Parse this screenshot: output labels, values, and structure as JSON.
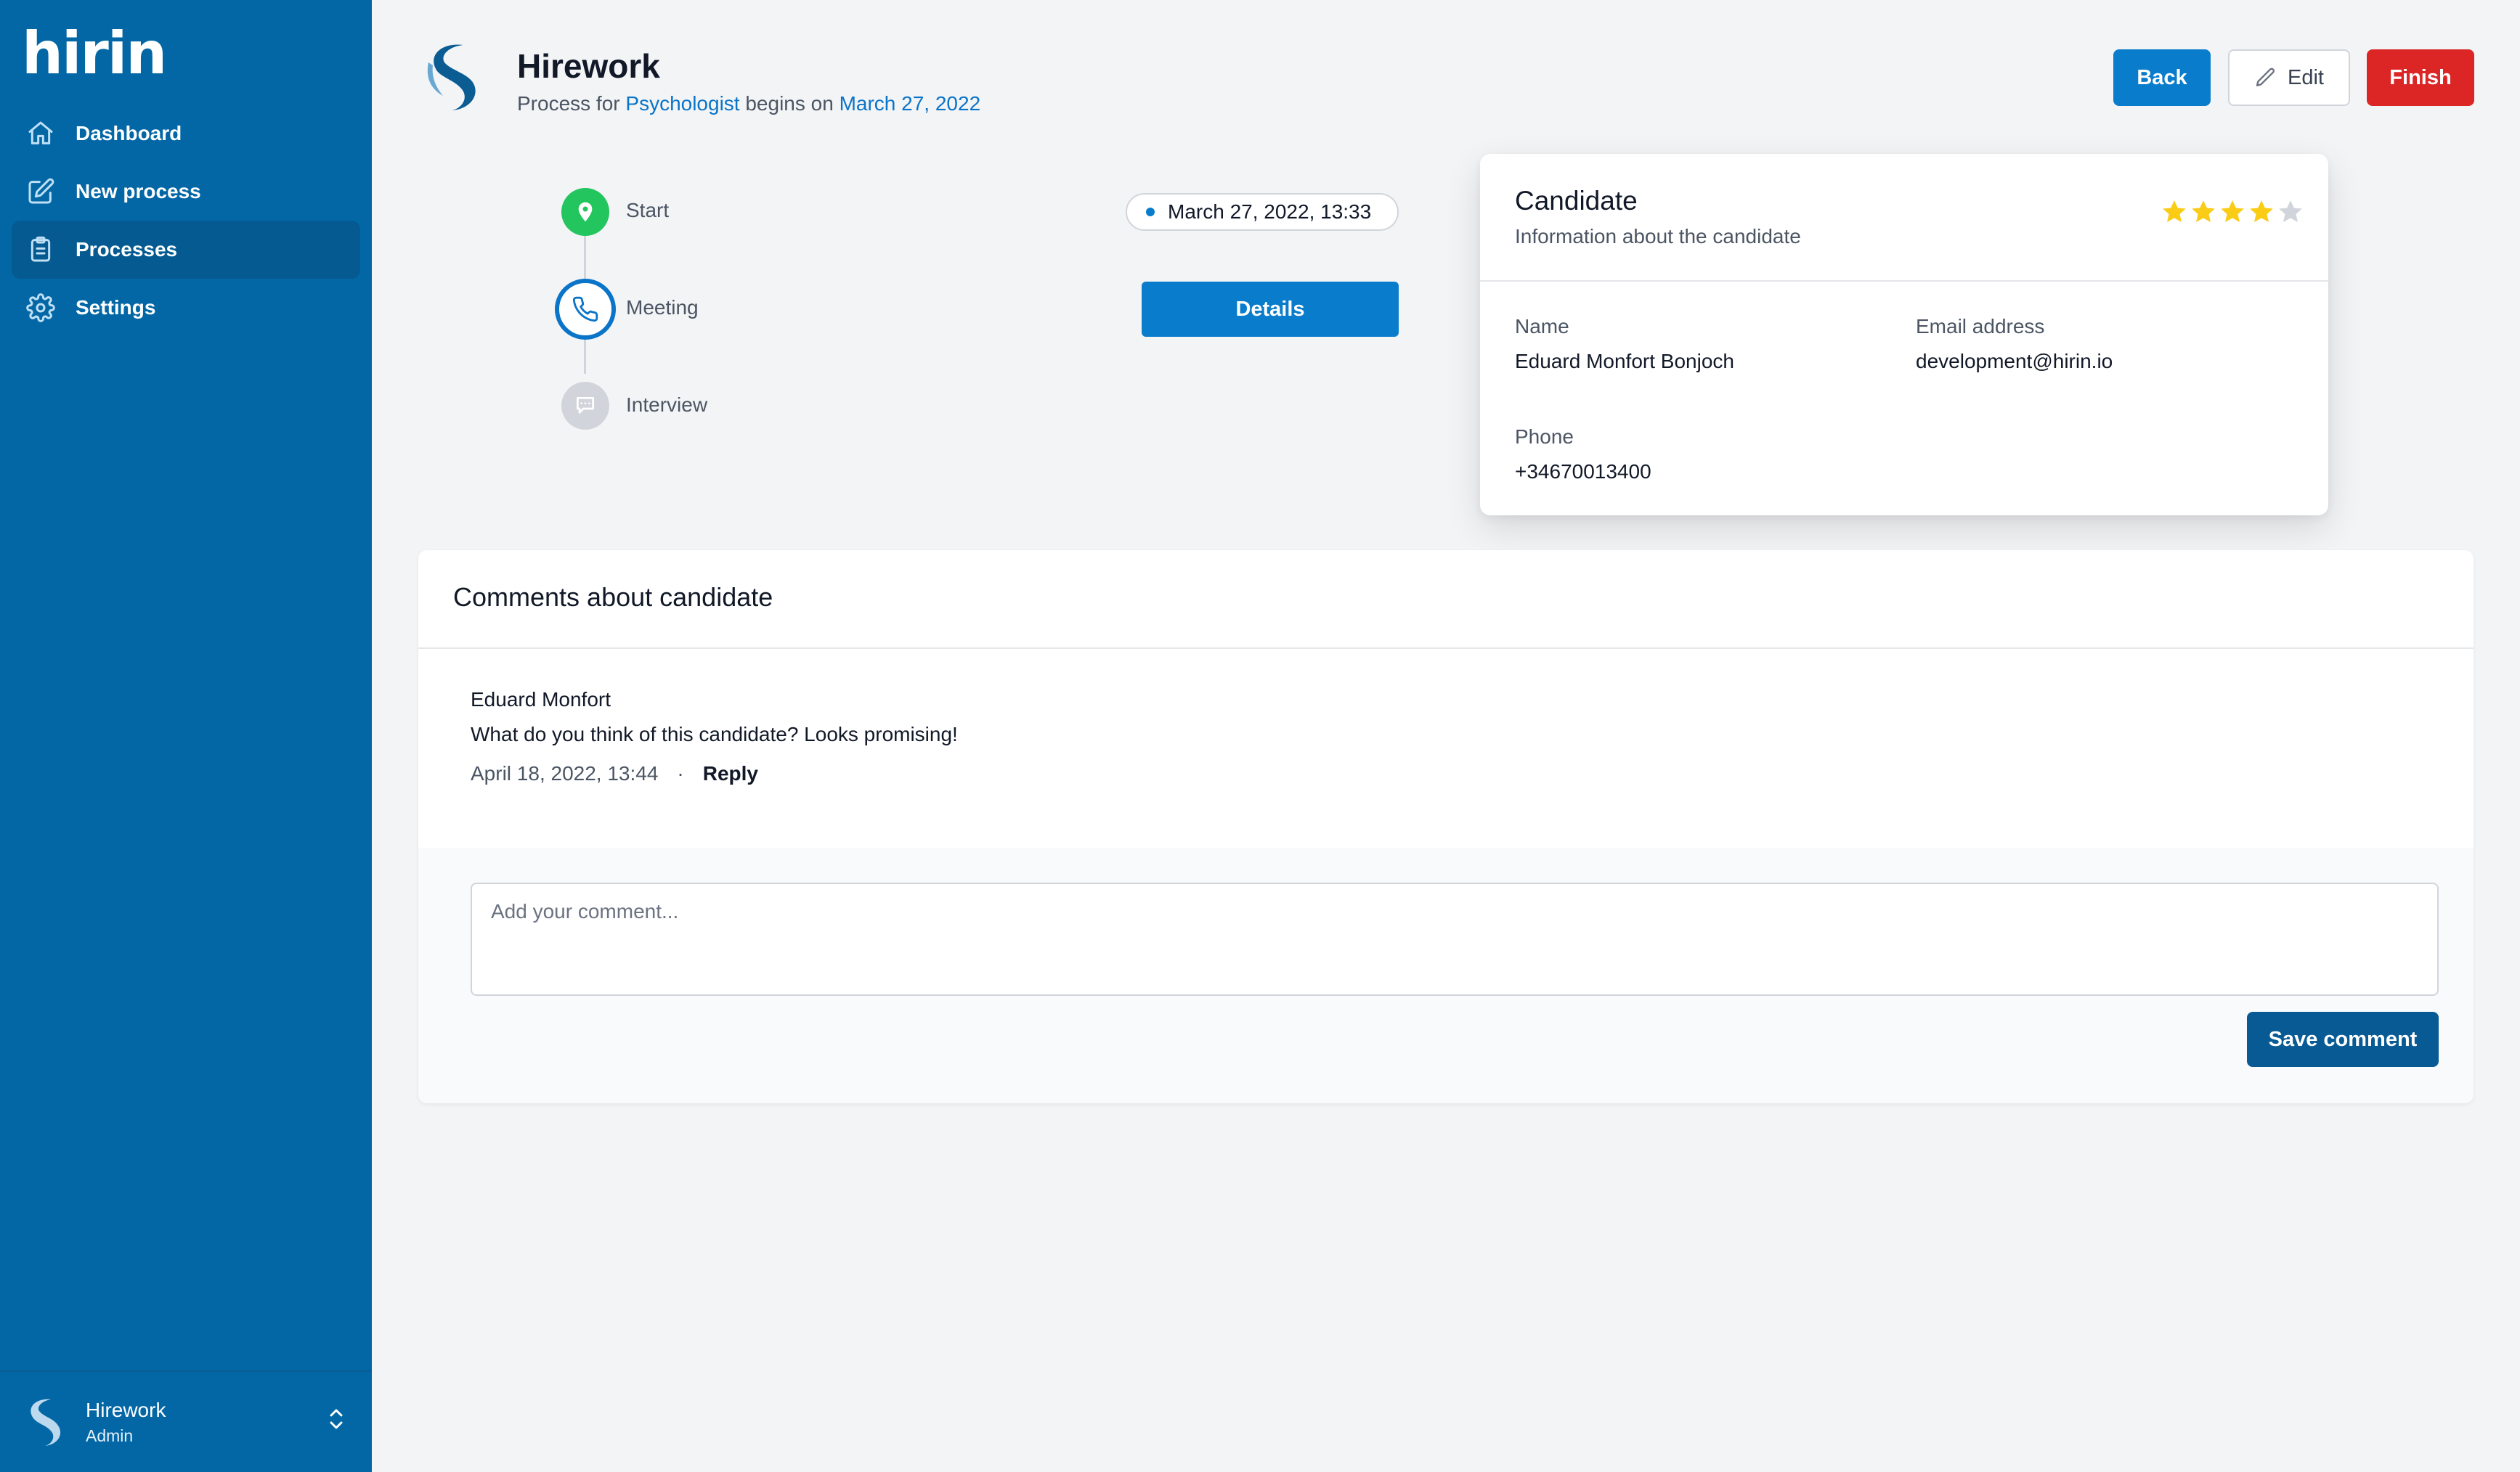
{
  "app": {
    "logo_text": "hirin"
  },
  "sidebar": {
    "items": [
      {
        "label": "Dashboard",
        "icon": "home-icon"
      },
      {
        "label": "New process",
        "icon": "edit-icon"
      },
      {
        "label": "Processes",
        "icon": "clipboard-icon",
        "active": true
      },
      {
        "label": "Settings",
        "icon": "gear-icon"
      }
    ],
    "footer": {
      "name": "Hirework",
      "role": "Admin"
    }
  },
  "header": {
    "company": "Hirework",
    "subtitle_prefix": "Process for ",
    "position": "Psychologist",
    "subtitle_mid": " begins on ",
    "start_date": "March 27, 2022",
    "buttons": {
      "back": "Back",
      "edit": "Edit",
      "finish": "Finish"
    }
  },
  "timeline": {
    "steps": [
      {
        "label": "Start",
        "icon": "location-pin-icon",
        "status": "done"
      },
      {
        "label": "Meeting",
        "icon": "phone-icon",
        "status": "current"
      },
      {
        "label": "Interview",
        "icon": "chat-bubble-icon",
        "status": "pending"
      }
    ],
    "start_timestamp": "March 27, 2022, 13:33",
    "details_button": "Details"
  },
  "candidate": {
    "title": "Candidate",
    "subtitle": "Information about the candidate",
    "rating": 4,
    "rating_max": 5,
    "fields": {
      "name_label": "Name",
      "name": "Eduard Monfort Bonjoch",
      "email_label": "Email address",
      "email": "development@hirin.io",
      "phone_label": "Phone",
      "phone": "+34670013400"
    }
  },
  "comments": {
    "title": "Comments about candidate",
    "items": [
      {
        "author": "Eduard Monfort",
        "text": "What do you think of this candidate? Looks promising!",
        "date": "April 18, 2022, 13:44",
        "separator": "·",
        "reply": "Reply"
      }
    ],
    "input_placeholder": "Add your comment...",
    "save_button": "Save comment"
  },
  "colors": {
    "sidebar": "#0367a6",
    "primary": "#0a7ccc",
    "danger": "#dc2626",
    "success": "#22c55e",
    "star": "#facc15"
  }
}
